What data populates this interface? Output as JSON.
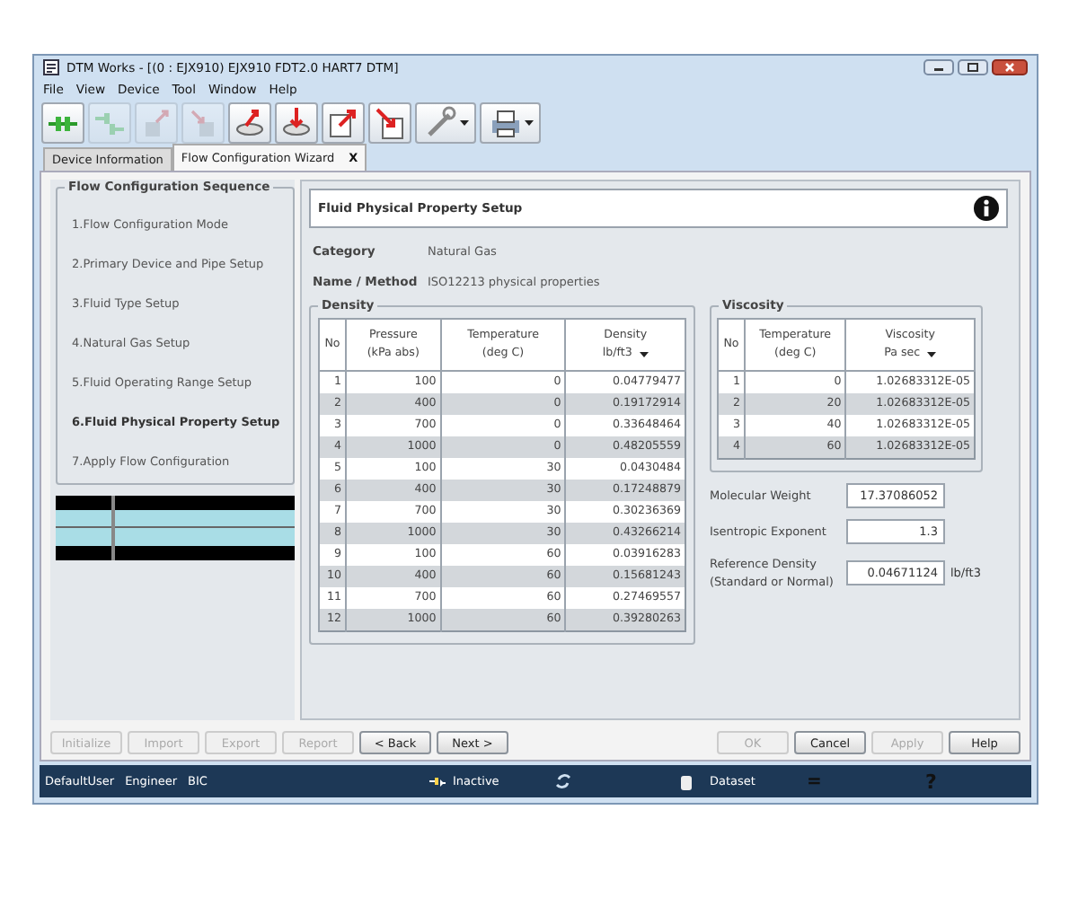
{
  "window": {
    "title": "DTM Works - [(0 : EJX910) EJX910 FDT2.0 HART7 DTM]"
  },
  "menu": [
    "File",
    "View",
    "Device",
    "Tool",
    "Window",
    "Help"
  ],
  "toolbar": [
    {
      "kind": "connect",
      "disabled": false,
      "dropdown": false
    },
    {
      "kind": "disconnect",
      "disabled": true,
      "dropdown": false
    },
    {
      "kind": "device-up",
      "disabled": true,
      "dropdown": false
    },
    {
      "kind": "device-down",
      "disabled": true,
      "dropdown": false
    },
    {
      "kind": "disk-up",
      "disabled": false,
      "dropdown": false
    },
    {
      "kind": "disk-down",
      "disabled": false,
      "dropdown": false
    },
    {
      "kind": "page-up",
      "disabled": false,
      "dropdown": false
    },
    {
      "kind": "page-down",
      "disabled": false,
      "dropdown": false
    },
    {
      "kind": "tools",
      "disabled": false,
      "dropdown": true
    },
    {
      "kind": "print",
      "disabled": false,
      "dropdown": true
    }
  ],
  "tabs": [
    {
      "label": "Device Information",
      "selected": false,
      "closable": false
    },
    {
      "label": "Flow Configuration Wizard",
      "selected": true,
      "closable": true,
      "close": "X"
    }
  ],
  "sequence": {
    "title": "Flow Configuration Sequence",
    "items": [
      {
        "label": "1.Flow Configuration Mode",
        "selected": false
      },
      {
        "label": "2.Primary Device and Pipe Setup",
        "selected": false
      },
      {
        "label": "3.Fluid Type Setup",
        "selected": false
      },
      {
        "label": "4.Natural Gas Setup",
        "selected": false
      },
      {
        "label": "5.Fluid Operating Range Setup",
        "selected": false
      },
      {
        "label": "6.Fluid Physical Property Setup",
        "selected": true
      },
      {
        "label": "7.Apply Flow Configuration",
        "selected": false
      }
    ]
  },
  "panel": {
    "title": "Fluid Physical Property Setup",
    "fields": [
      {
        "label": "Category",
        "value": "Natural Gas"
      },
      {
        "label": "Name / Method",
        "value": "ISO12213 physical properties"
      }
    ],
    "density": {
      "title": "Density",
      "columns": [
        {
          "label": "No"
        },
        {
          "label": "Pressure",
          "unit": "(kPa abs)"
        },
        {
          "label": "Temperature",
          "unit": "(deg C)"
        },
        {
          "label": "Density",
          "unit": "lb/ft3"
        }
      ],
      "unit_dropdown": true,
      "rows": [
        [
          "1",
          "100",
          "0",
          "0.04779477"
        ],
        [
          "2",
          "400",
          "0",
          "0.19172914"
        ],
        [
          "3",
          "700",
          "0",
          "0.33648464"
        ],
        [
          "4",
          "1000",
          "0",
          "0.48205559"
        ],
        [
          "5",
          "100",
          "30",
          "0.0430484"
        ],
        [
          "6",
          "400",
          "30",
          "0.17248879"
        ],
        [
          "7",
          "700",
          "30",
          "0.30236369"
        ],
        [
          "8",
          "1000",
          "30",
          "0.43266214"
        ],
        [
          "9",
          "100",
          "60",
          "0.03916283"
        ],
        [
          "10",
          "400",
          "60",
          "0.15681243"
        ],
        [
          "11",
          "700",
          "60",
          "0.27469557"
        ],
        [
          "12",
          "1000",
          "60",
          "0.39280263"
        ]
      ]
    },
    "viscosity": {
      "title": "Viscosity",
      "columns": [
        {
          "label": "No"
        },
        {
          "label": "Temperature",
          "unit": "(deg C)"
        },
        {
          "label": "Viscosity",
          "unit": "Pa sec"
        }
      ],
      "unit_dropdown": true,
      "rows": [
        [
          "1",
          "0",
          "1.02683312E-05"
        ],
        [
          "2",
          "20",
          "1.02683312E-05"
        ],
        [
          "3",
          "40",
          "1.02683312E-05"
        ],
        [
          "4",
          "60",
          "1.02683312E-05"
        ]
      ]
    },
    "properties": [
      {
        "label": [
          "Molecular Weight"
        ],
        "value": "17.37086052"
      },
      {
        "label": [
          "Isentropic Exponent"
        ],
        "value": "1.3"
      },
      {
        "label": [
          "Reference Density",
          "(Standard or Normal)"
        ],
        "value": "0.04671124",
        "unit": "lb/ft3"
      }
    ]
  },
  "buttons_left": [
    {
      "label": "Initialize",
      "disabled": true
    },
    {
      "label": "Import",
      "disabled": true
    },
    {
      "label": "Export",
      "disabled": true
    },
    {
      "label": "Report",
      "disabled": true
    },
    {
      "label": "< Back",
      "disabled": false
    },
    {
      "label": "Next >",
      "disabled": false
    }
  ],
  "buttons_right": [
    {
      "label": "OK",
      "disabled": true
    },
    {
      "label": "Cancel",
      "disabled": false
    },
    {
      "label": "Apply",
      "disabled": true
    },
    {
      "label": "Help",
      "disabled": false
    }
  ],
  "status_bar": {
    "user": "DefaultUser",
    "role": "Engineer",
    "group": "BIC",
    "connection": "Inactive",
    "dataset": "Dataset",
    "equals": "=",
    "help": "?"
  }
}
